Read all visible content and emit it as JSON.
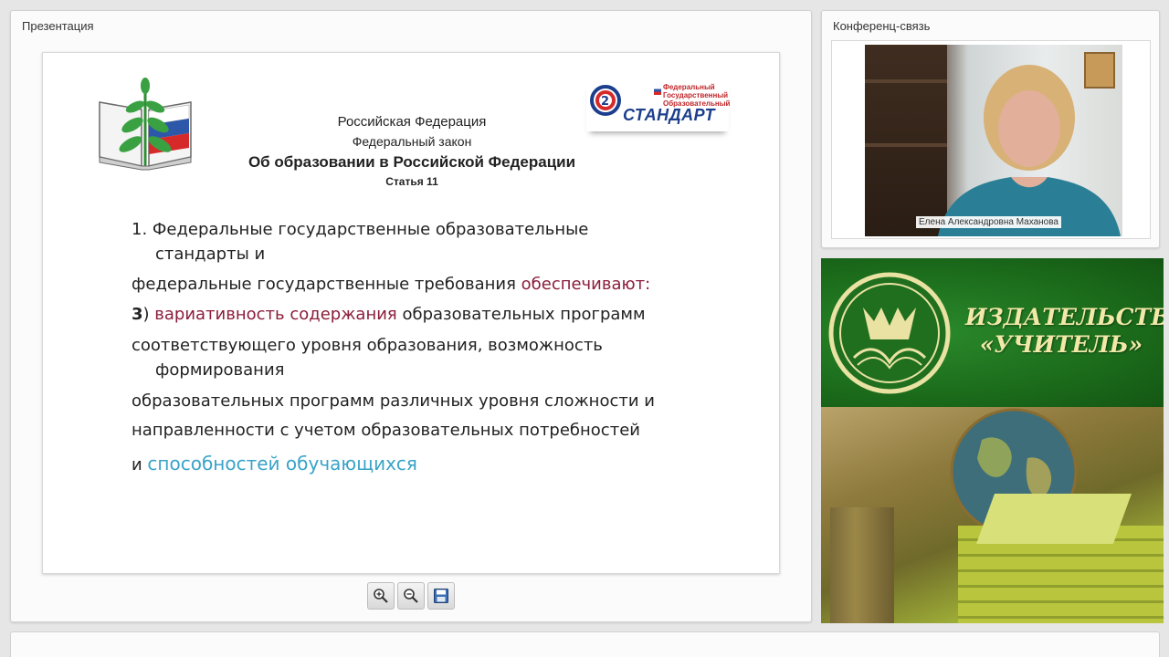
{
  "presentation_panel": {
    "title": "Презентация"
  },
  "slide": {
    "standard_logo": {
      "line1": "Федеральный",
      "line2": "Государственный",
      "line3": "Образовательный",
      "brand": "СТАНДАРТ"
    },
    "header": {
      "country": "Российская Федерация",
      "law": "Федеральный закон",
      "title": "Об образовании в Российской Федерации",
      "article": "Статья 11"
    },
    "body": {
      "p1_line1": "1. Федеральные государственные образовательные",
      "p1_line2": "стандарты и",
      "p2_text": "федеральные государственные требования ",
      "p2_highlight": "обеспечивают:",
      "p3_number": "3",
      "p3_paren": ") ",
      "p3_highlight": "вариативность содержания",
      "p3_text": " образовательных программ",
      "p4_line1": "соответствующего уровня образования, возможность",
      "p4_line2": "формирования",
      "p5_text": "образовательных программ различных уровня сложности и",
      "p6_text": "направленности с учетом образовательных потребностей",
      "p7_text": "и ",
      "p7_highlight": "способностей обучающихся"
    }
  },
  "toolbar": {
    "zoom_in_icon": "zoom-in-icon",
    "zoom_out_icon": "zoom-out-icon",
    "save_icon": "save-icon"
  },
  "conference_panel": {
    "title": "Конференц-связь",
    "participant_name": "Елена Александровна Маханова"
  },
  "publisher": {
    "line1": "ИЗДАТЕЛЬСТВО",
    "line2": "«УЧИТЕЛЬ»"
  },
  "colors": {
    "highlight_red": "#8b1d3a",
    "highlight_blue": "#3aa3c8",
    "publisher_green": "#1b6b1b",
    "publisher_text": "#f2e9a8"
  }
}
